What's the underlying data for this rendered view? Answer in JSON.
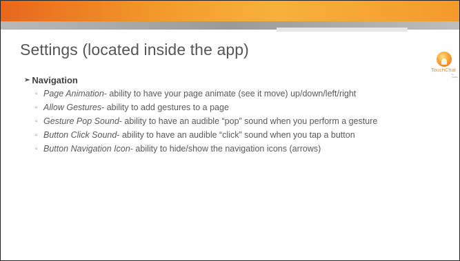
{
  "slide": {
    "title": "Settings (located inside the app)",
    "logo": {
      "text": "TouchChat",
      "subtext": "by Saltillo"
    },
    "section": {
      "heading": "Navigation",
      "items": [
        {
          "term": "Page Animation",
          "text": "- ability to have your page animate (see it move) up/down/left/right"
        },
        {
          "term": " Allow Gestures",
          "text": "- ability to add gestures to a page"
        },
        {
          "term": "Gesture Pop Sound",
          "text": "- ability to have an audible “pop” sound when you perform a gesture"
        },
        {
          "term": "Button Click Sound",
          "text": "- ability to have an audible “click” sound when you tap a button"
        },
        {
          "term": "Button Navigation Icon",
          "text": "- ability to hide/show the navigation icons (arrows)"
        }
      ]
    }
  },
  "colors": {
    "accent_orange": "#f39a2a",
    "band_gray": "#a8a8a8",
    "title_gray": "#555555"
  }
}
